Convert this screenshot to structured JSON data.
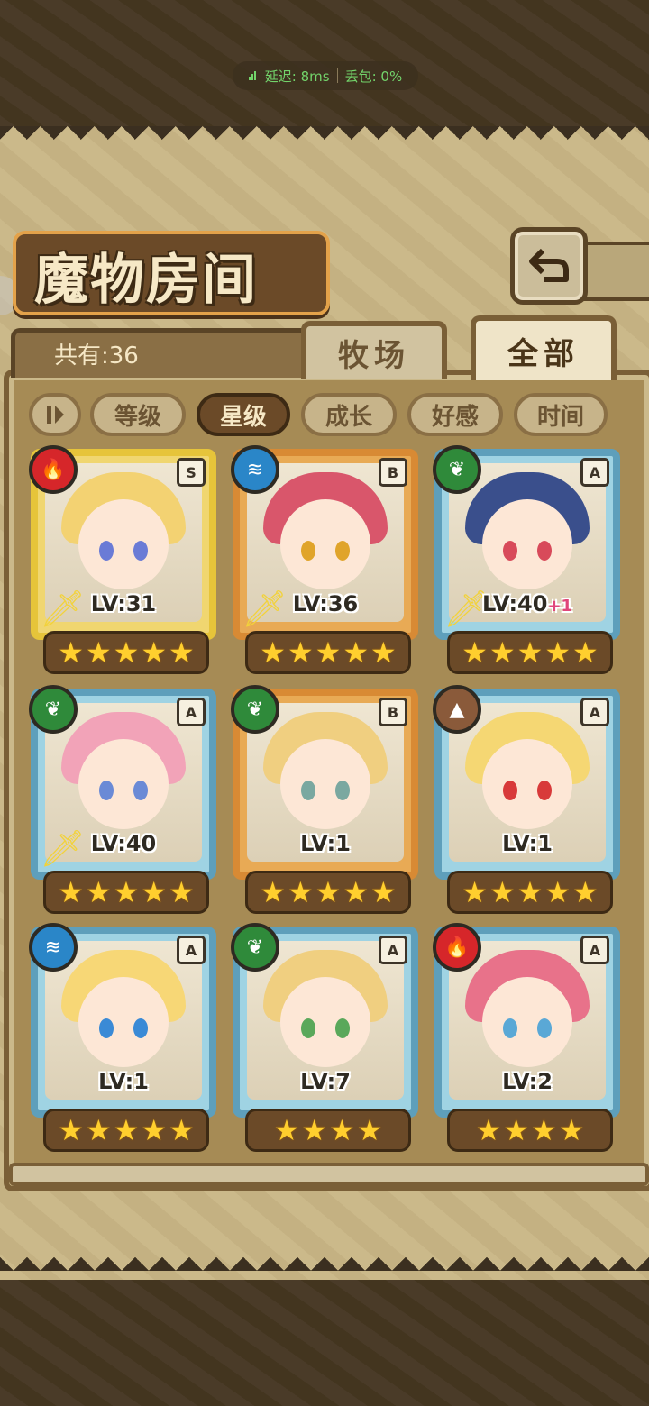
{
  "status": {
    "latency_label": "延迟: 8ms",
    "loss_label": "丢包: 0%"
  },
  "header": {
    "title": "魔物房间",
    "back_icon": "back-arrow-icon"
  },
  "summary": {
    "count_label": "共有:36"
  },
  "tabs": [
    {
      "label": "牧场",
      "active": false
    },
    {
      "label": "全部",
      "active": true
    }
  ],
  "sort": {
    "toggle_icon": "pause-sort-icon",
    "options": [
      {
        "label": "等级",
        "active": false
      },
      {
        "label": "星级",
        "active": true
      },
      {
        "label": "成长",
        "active": false
      },
      {
        "label": "好感",
        "active": false
      },
      {
        "label": "时间",
        "active": false
      }
    ]
  },
  "monsters": [
    {
      "element": "fire",
      "rank": "S",
      "level": "LV:31",
      "bonus": "",
      "stars": 5,
      "frame": "gold",
      "weapon": true
    },
    {
      "element": "water",
      "rank": "B",
      "level": "LV:36",
      "bonus": "",
      "stars": 5,
      "frame": "orange",
      "weapon": true
    },
    {
      "element": "nature",
      "rank": "A",
      "level": "LV:40",
      "bonus": "+1",
      "stars": 5,
      "frame": "blue",
      "weapon": true
    },
    {
      "element": "nature",
      "rank": "A",
      "level": "LV:40",
      "bonus": "",
      "stars": 5,
      "frame": "blue",
      "weapon": true
    },
    {
      "element": "nature",
      "rank": "B",
      "level": "LV:1",
      "bonus": "",
      "stars": 5,
      "frame": "orange",
      "weapon": false
    },
    {
      "element": "earth",
      "rank": "A",
      "level": "LV:1",
      "bonus": "",
      "stars": 5,
      "frame": "blue",
      "weapon": false
    },
    {
      "element": "water",
      "rank": "A",
      "level": "LV:1",
      "bonus": "",
      "stars": 5,
      "frame": "blue",
      "weapon": false
    },
    {
      "element": "nature",
      "rank": "A",
      "level": "LV:7",
      "bonus": "",
      "stars": 4,
      "frame": "blue",
      "weapon": false
    },
    {
      "element": "fire",
      "rank": "A",
      "level": "LV:2",
      "bonus": "",
      "stars": 4,
      "frame": "blue",
      "weapon": false
    }
  ],
  "colors": {
    "fire": "#d6262a",
    "water": "#2a86c8",
    "nature": "#2f8a3a",
    "earth": "#8a5a3a"
  }
}
